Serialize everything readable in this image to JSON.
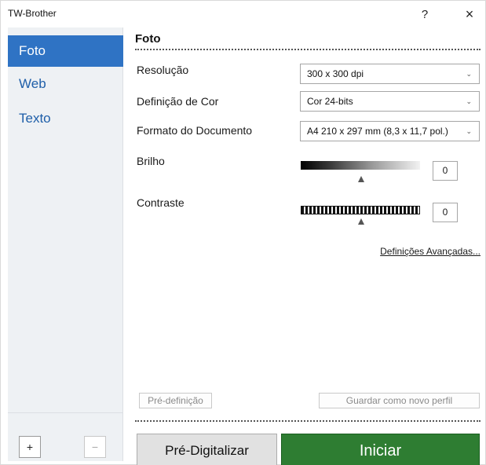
{
  "window": {
    "title": "TW-Brother",
    "help_label": "?",
    "close_label": "×"
  },
  "sidebar": {
    "items": [
      {
        "label": "Foto",
        "active": true
      },
      {
        "label": "Web",
        "active": false
      },
      {
        "label": "Texto",
        "active": false
      }
    ],
    "add_label": "+",
    "remove_label": "−"
  },
  "main": {
    "section_title": "Foto",
    "resolution": {
      "label": "Resolução",
      "value": "300 x 300 dpi"
    },
    "color": {
      "label": "Definição de Cor",
      "value": "Cor 24-bits"
    },
    "document_size": {
      "label": "Formato do Documento",
      "value": "A4 210 x 297 mm (8,3 x 11,7 pol.)"
    },
    "brightness": {
      "label": "Brilho",
      "value": "0"
    },
    "contrast": {
      "label": "Contraste",
      "value": "0"
    },
    "advanced_link": "Definições Avançadas...",
    "preset_button": "Pré-definição",
    "save_profile_button": "Guardar como novo perfil",
    "prescan_button": "Pré-Digitalizar",
    "start_button": "Iniciar"
  },
  "colors": {
    "accent": "#2f73c4",
    "start_button": "#2e7d32",
    "sidebar_bg": "#eef1f4"
  },
  "icons": {
    "dropdown": "chevron-down-icon",
    "slider_thumb": "triangle-up-icon"
  }
}
